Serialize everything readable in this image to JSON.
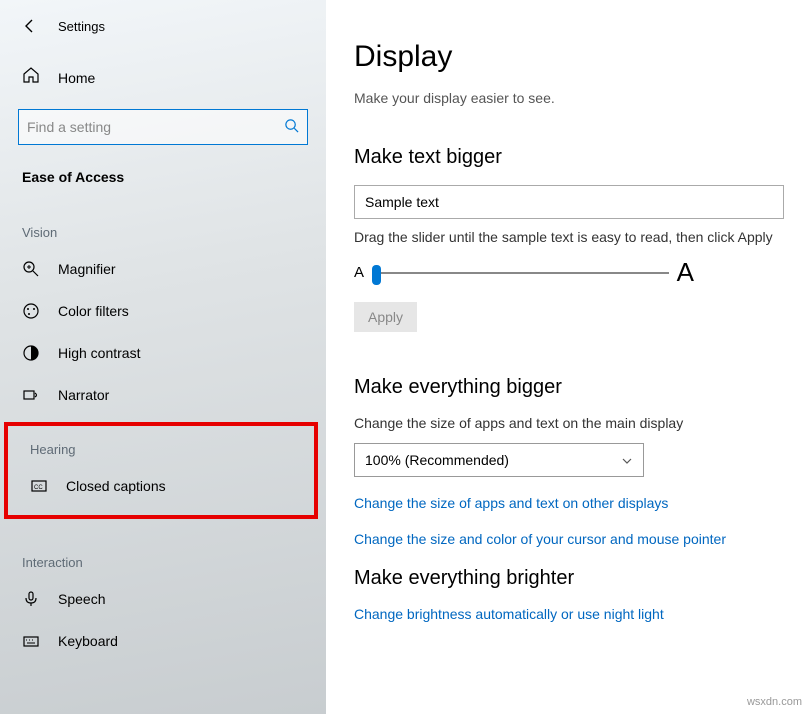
{
  "header": {
    "title": "Settings"
  },
  "home": {
    "label": "Home"
  },
  "search": {
    "placeholder": "Find a setting"
  },
  "section": "Ease of Access",
  "groups": {
    "vision": {
      "label": "Vision",
      "items": [
        {
          "label": "Magnifier"
        },
        {
          "label": "Color filters"
        },
        {
          "label": "High contrast"
        },
        {
          "label": "Narrator"
        }
      ]
    },
    "hearing": {
      "label": "Hearing",
      "items": [
        {
          "label": "Closed captions"
        }
      ]
    },
    "interaction": {
      "label": "Interaction",
      "items": [
        {
          "label": "Speech"
        },
        {
          "label": "Keyboard"
        }
      ]
    }
  },
  "main": {
    "heading": "Display",
    "subhead": "Make your display easier to see.",
    "text_bigger": {
      "title": "Make text bigger",
      "sample": "Sample text",
      "instruction": "Drag the slider until the sample text is easy to read, then click Apply",
      "small_a": "A",
      "big_a": "A",
      "apply": "Apply"
    },
    "everything_bigger": {
      "title": "Make everything bigger",
      "desc": "Change the size of apps and text on the main display",
      "dropdown_value": "100% (Recommended)",
      "link1": "Change the size of apps and text on other displays",
      "link2": "Change the size and color of your cursor and mouse pointer"
    },
    "brighter": {
      "title": "Make everything brighter",
      "link": "Change brightness automatically or use night light"
    }
  },
  "watermark": "wsxdn.com"
}
